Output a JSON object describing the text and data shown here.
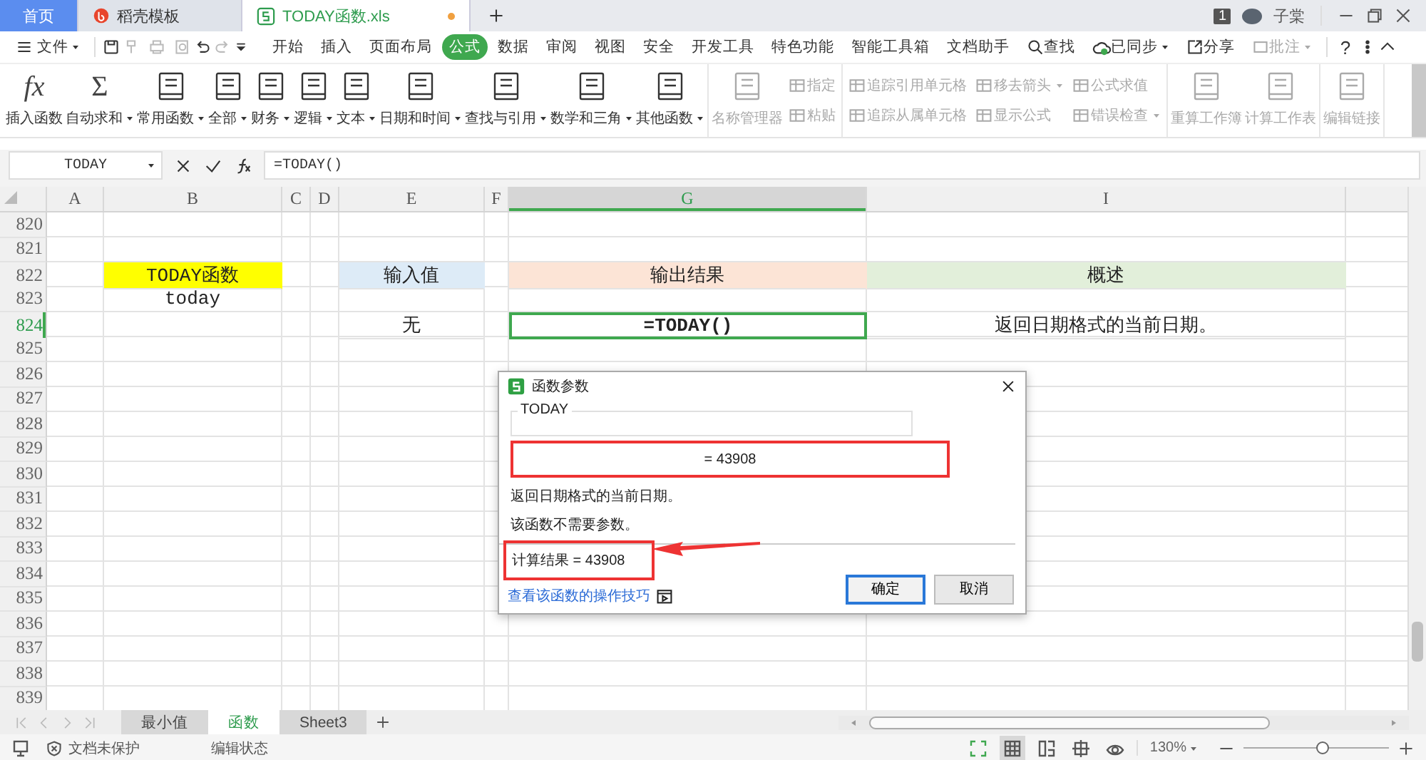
{
  "window": {
    "tabs": [
      {
        "label": "首页",
        "kind": "home",
        "selected": false,
        "unsaved": false
      },
      {
        "label": "稻壳模板",
        "kind": "docer",
        "selected": false,
        "unsaved": false
      },
      {
        "label": "TODAY函数.xls",
        "kind": "sheet",
        "selected": true,
        "unsaved": true
      }
    ],
    "notice_count": "1",
    "user": "子棠"
  },
  "menu": {
    "file": "文件",
    "tabs": [
      {
        "label": "开始",
        "selected": false
      },
      {
        "label": "插入",
        "selected": false
      },
      {
        "label": "页面布局",
        "selected": false
      },
      {
        "label": "公式",
        "selected": true
      },
      {
        "label": "数据",
        "selected": false
      },
      {
        "label": "审阅",
        "selected": false
      },
      {
        "label": "视图",
        "selected": false
      },
      {
        "label": "安全",
        "selected": false
      },
      {
        "label": "开发工具",
        "selected": false
      },
      {
        "label": "特色功能",
        "selected": false
      },
      {
        "label": "智能工具箱",
        "selected": false
      },
      {
        "label": "文档助手",
        "selected": false
      }
    ],
    "search": "查找",
    "sync": "已同步",
    "share": "分享",
    "comment": "批注",
    "help": "?"
  },
  "ribbon": {
    "groups": [
      {
        "items": [
          {
            "kind": "glyph",
            "glyph": "fx",
            "label": "插入函数",
            "dropdown": false,
            "disabled": false
          },
          {
            "kind": "glyph",
            "glyph": "Σ",
            "label": "自动求和",
            "dropdown": true,
            "disabled": false
          },
          {
            "kind": "big",
            "label": "常用函数",
            "dropdown": true,
            "disabled": false
          },
          {
            "kind": "big",
            "label": "全部",
            "dropdown": true,
            "disabled": false
          },
          {
            "kind": "big",
            "label": "财务",
            "dropdown": true,
            "disabled": false
          },
          {
            "kind": "big",
            "label": "逻辑",
            "dropdown": true,
            "disabled": false
          },
          {
            "kind": "big",
            "label": "文本",
            "dropdown": true,
            "disabled": false
          },
          {
            "kind": "big",
            "label": "日期和时间",
            "dropdown": true,
            "disabled": false
          },
          {
            "kind": "big",
            "label": "查找与引用",
            "dropdown": true,
            "disabled": false
          },
          {
            "kind": "big",
            "label": "数学和三角",
            "dropdown": true,
            "disabled": false
          },
          {
            "kind": "big",
            "label": "其他函数",
            "dropdown": true,
            "disabled": false
          }
        ]
      },
      {
        "items": [
          {
            "kind": "big",
            "label": "名称管理器",
            "dropdown": false,
            "disabled": true
          },
          {
            "kind": "stack",
            "items": [
              {
                "label": "指定",
                "dropdown": false,
                "disabled": true
              },
              {
                "label": "粘贴",
                "dropdown": false,
                "disabled": true
              }
            ]
          }
        ]
      },
      {
        "items": [
          {
            "kind": "stack",
            "items": [
              {
                "label": "追踪引用单元格",
                "dropdown": false,
                "disabled": true
              },
              {
                "label": "追踪从属单元格",
                "dropdown": false,
                "disabled": true
              }
            ]
          },
          {
            "kind": "stack",
            "items": [
              {
                "label": "移去箭头",
                "dropdown": true,
                "disabled": true
              },
              {
                "label": "显示公式",
                "dropdown": false,
                "disabled": true
              }
            ]
          },
          {
            "kind": "stack",
            "items": [
              {
                "label": "公式求值",
                "dropdown": false,
                "disabled": true
              },
              {
                "label": "错误检查",
                "dropdown": true,
                "disabled": true
              }
            ]
          }
        ]
      },
      {
        "items": [
          {
            "kind": "big",
            "label": "重算工作簿",
            "dropdown": false,
            "disabled": true
          },
          {
            "kind": "big",
            "label": "计算工作表",
            "dropdown": false,
            "disabled": true
          }
        ]
      },
      {
        "items": [
          {
            "kind": "big",
            "label": "编辑链接",
            "dropdown": false,
            "disabled": true
          }
        ]
      }
    ]
  },
  "formula_bar": {
    "name_box": "TODAY",
    "formula": "=TODAY()"
  },
  "sheet": {
    "columns": [
      {
        "label": "A",
        "selected": false
      },
      {
        "label": "B",
        "selected": false
      },
      {
        "label": "C",
        "selected": false
      },
      {
        "label": "D",
        "selected": false
      },
      {
        "label": "E",
        "selected": false
      },
      {
        "label": "F",
        "selected": false
      },
      {
        "label": "G",
        "selected": true
      },
      {
        "label": "I",
        "selected": false
      }
    ],
    "rows": [
      {
        "number": "820",
        "selected": false
      },
      {
        "number": "821",
        "selected": false
      },
      {
        "number": "822",
        "selected": false,
        "cells": [
          {},
          {
            "text": "TODAY函数",
            "color": "#ffff00"
          },
          {},
          {},
          {
            "text": "输入值",
            "color": "#ddebf7"
          },
          {},
          {
            "text": "输出结果",
            "color": "#fce4d6"
          },
          {
            "text": "概述",
            "color": "#e2efda"
          }
        ]
      },
      {
        "number": "823",
        "selected": false,
        "cells": [
          {},
          {
            "text": "today"
          },
          {},
          {},
          {},
          {},
          {},
          {}
        ]
      },
      {
        "number": "824",
        "selected": true,
        "cells": [
          {},
          {},
          {},
          {},
          {
            "text": "无"
          },
          {},
          {
            "text": "=TODAY()",
            "bold": true
          },
          {
            "text": "返回日期格式的当前日期。"
          }
        ]
      },
      {
        "number": "825",
        "selected": false
      },
      {
        "number": "826",
        "selected": false
      },
      {
        "number": "827",
        "selected": false
      },
      {
        "number": "828",
        "selected": false
      },
      {
        "number": "829",
        "selected": false
      },
      {
        "number": "830",
        "selected": false
      },
      {
        "number": "831",
        "selected": false
      },
      {
        "number": "832",
        "selected": false
      },
      {
        "number": "833",
        "selected": false
      },
      {
        "number": "834",
        "selected": false
      },
      {
        "number": "835",
        "selected": false
      },
      {
        "number": "836",
        "selected": false
      },
      {
        "number": "837",
        "selected": false
      },
      {
        "number": "838",
        "selected": false
      },
      {
        "number": "839",
        "selected": false
      }
    ]
  },
  "dialog": {
    "title": "函数参数",
    "function": "TODAY",
    "result": "=  43908",
    "description": "返回日期格式的当前日期。",
    "note": "该函数不需要参数。",
    "calc_result": "计算结果  =  43908",
    "link": "查看该函数的操作技巧",
    "buttons": [
      {
        "label": "确定",
        "primary": true
      },
      {
        "label": "取消",
        "primary": false
      }
    ]
  },
  "sheet_tabs": [
    {
      "label": "最小值",
      "selected": false
    },
    {
      "label": "函数",
      "selected": true
    },
    {
      "label": "Sheet3",
      "selected": false
    }
  ],
  "status_bar": {
    "protection": "文档未保护",
    "mode": "编辑状态",
    "views": [
      {
        "kind": "fullscreen",
        "selected": false
      },
      {
        "kind": "normal",
        "selected": true
      },
      {
        "kind": "pagebreak",
        "selected": false
      },
      {
        "kind": "layout",
        "selected": false
      },
      {
        "kind": "eye",
        "selected": false
      }
    ],
    "zoom": "130%",
    "zoom_slider": {
      "level": 0.54
    }
  }
}
